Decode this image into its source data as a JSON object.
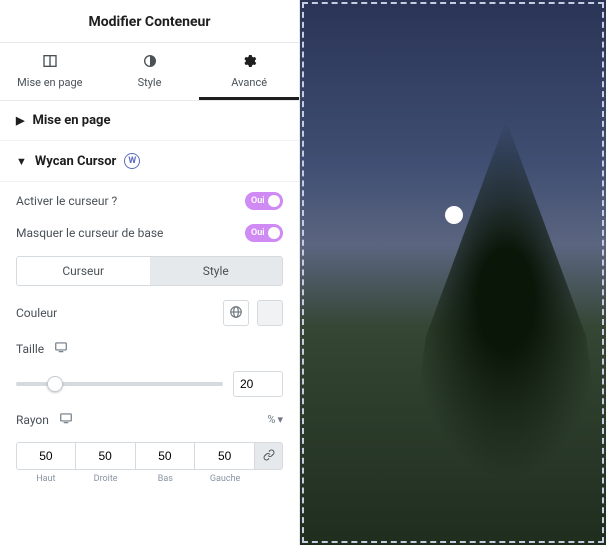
{
  "panel": {
    "title": "Modifier Conteneur",
    "tabs": [
      {
        "label": "Mise en page"
      },
      {
        "label": "Style"
      },
      {
        "label": "Avancé"
      }
    ]
  },
  "sections": {
    "layout": {
      "title": "Mise en page"
    },
    "wycan": {
      "title": "Wycan Cursor",
      "fields": {
        "activate": {
          "label": "Activer le curseur ?",
          "value": "Oui"
        },
        "hideBase": {
          "label": "Masquer le curseur de base",
          "value": "Oui"
        }
      },
      "subtabs": {
        "cursor": "Curseur",
        "style": "Style"
      },
      "color": {
        "label": "Couleur"
      },
      "size": {
        "label": "Taille",
        "value": "20"
      },
      "radius": {
        "label": "Rayon",
        "unit": "%",
        "top": "50",
        "right": "50",
        "bottom": "50",
        "left": "50",
        "captions": {
          "top": "Haut",
          "right": "Droite",
          "bottom": "Bas",
          "left": "Gauche"
        }
      }
    }
  }
}
